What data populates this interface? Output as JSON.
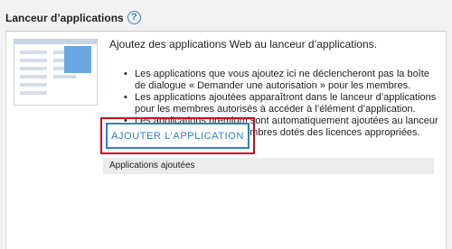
{
  "header": {
    "title": "Lanceur d’applications",
    "help_glyph": "?"
  },
  "intro": "Ajoutez des applications Web au lanceur d’applications.",
  "bullets": [
    "Les applications que vous ajoutez ici ne déclencheront pas la boîte de dialogue « Demander une autorisation » pour les membres.",
    "Les applications ajoutées apparaîtront dans le lanceur d’applications pour les membres autorisés à accéder à l’élément d’application.",
    "Les applications premium sont automatiquement ajoutées au lanceur d’applications pour les membres dotés des licences appropriées."
  ],
  "add_button_label": "AJOUTER L’APPLICATION",
  "added_apps_header": "Applications ajoutées",
  "colors": {
    "accent": "#2f7fc8",
    "highlight": "#d0021b",
    "illustration_block": "#6aa6df"
  },
  "icons": {
    "help": "help-circle-icon",
    "illustration": "app-launcher-illustration"
  }
}
